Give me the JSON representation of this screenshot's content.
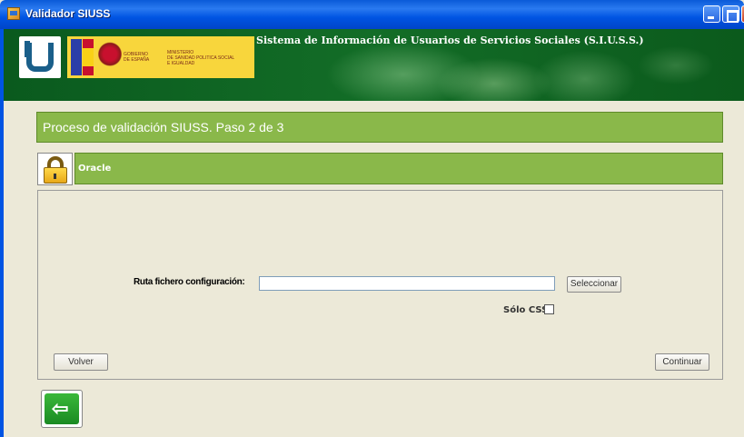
{
  "window": {
    "title": "Validador SIUSS"
  },
  "banner": {
    "title": "Sistema de Información de Usuarios de Servicios Sociales (S.I.U.S.S.)",
    "gov_line1": "GOBIERNO",
    "gov_line2": "DE ESPAÑA",
    "ministry_line1": "MINISTERIO",
    "ministry_line2": "DE SANIDAD POLITICA SOCIAL",
    "ministry_line3": "E IGUALDAD"
  },
  "step": {
    "text": "Proceso de validación SIUSS.  Paso 2 de 3"
  },
  "section": {
    "title": "Oracle"
  },
  "form": {
    "ruta_label": "Ruta fichero configuración:",
    "ruta_value": "",
    "select_button": "Seleccionar",
    "css_label": "Sólo CSS",
    "css_checked": false
  },
  "footer": {
    "back_button": "Volver",
    "continue_button": "Continuar"
  },
  "colors": {
    "title_bar": "#0054e3",
    "banner_green": "#136d27",
    "panel_green": "#8ab84a",
    "background": "#ece9d8"
  }
}
